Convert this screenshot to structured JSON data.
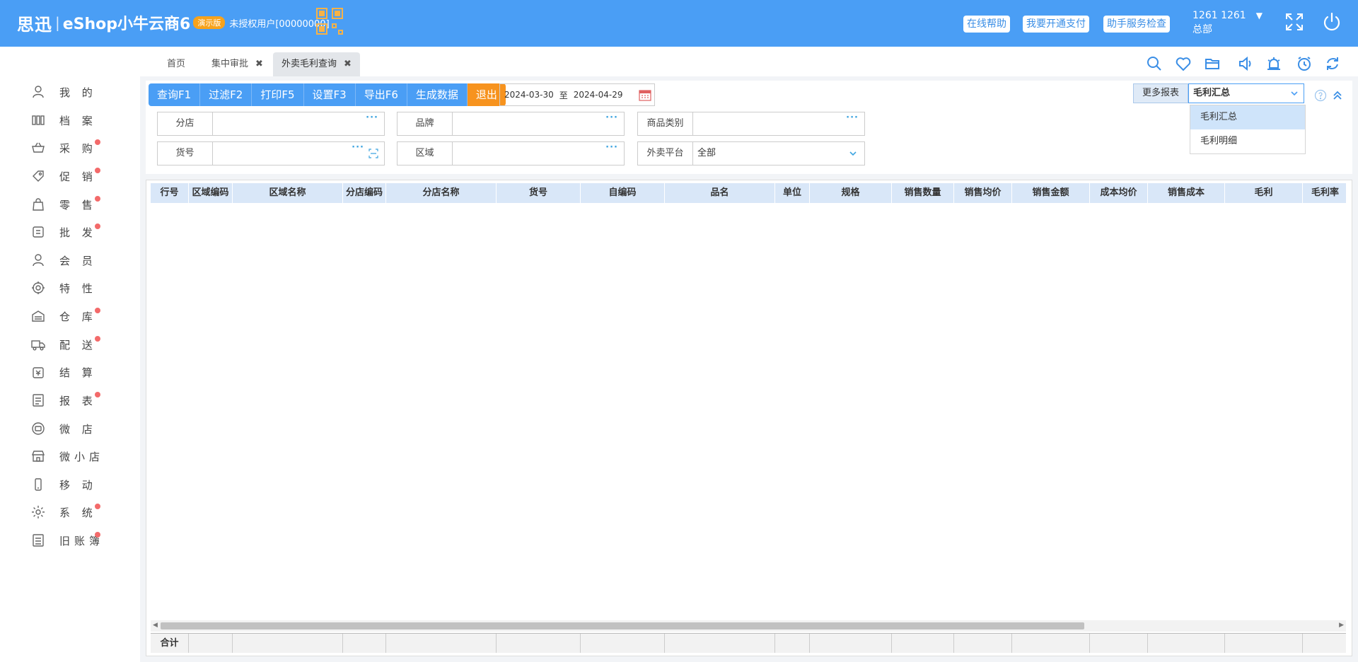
{
  "header": {
    "logo": "思迅",
    "product": "eShop小牛云商6",
    "edition_badge": "演示版",
    "license_user": "未授权用户[00000000]",
    "buttons": {
      "online_help": "在线帮助",
      "open_payment": "我要开通支付",
      "assistant_check": "助手服务检查"
    },
    "account": {
      "user": "1261 1261",
      "branch": "总部"
    },
    "icons": [
      "qrcode-icon",
      "fullscreen-icon",
      "power-icon"
    ]
  },
  "sidebar": {
    "items": [
      {
        "label": "我 的",
        "icon": "user-icon",
        "dot": false
      },
      {
        "label": "档 案",
        "icon": "archive-icon",
        "dot": false
      },
      {
        "label": "采 购",
        "icon": "basket-icon",
        "dot": true
      },
      {
        "label": "促 销",
        "icon": "tag-icon",
        "dot": true
      },
      {
        "label": "零 售",
        "icon": "bag-icon",
        "dot": true
      },
      {
        "label": "批 发",
        "icon": "wholesale-icon",
        "dot": true
      },
      {
        "label": "会 员",
        "icon": "member-icon",
        "dot": false
      },
      {
        "label": "特 性",
        "icon": "feature-icon",
        "dot": false
      },
      {
        "label": "仓 库",
        "icon": "warehouse-icon",
        "dot": true
      },
      {
        "label": "配 送",
        "icon": "truck-icon",
        "dot": true
      },
      {
        "label": "结 算",
        "icon": "settlement-icon",
        "dot": false
      },
      {
        "label": "报 表",
        "icon": "report-icon",
        "dot": true
      },
      {
        "label": "微 店",
        "icon": "wechat-shop-icon",
        "dot": false
      },
      {
        "label": "微小店",
        "icon": "mini-shop-icon",
        "dot": false
      },
      {
        "label": "移 动",
        "icon": "mobile-icon",
        "dot": false
      },
      {
        "label": "系 统",
        "icon": "gear-icon",
        "dot": true
      },
      {
        "label": "旧账簿",
        "icon": "ledger-icon",
        "dot": true
      }
    ]
  },
  "tabs": [
    {
      "label": "首页",
      "closable": false,
      "active": false
    },
    {
      "label": "集中审批",
      "closable": true,
      "active": false
    },
    {
      "label": "外卖毛利查询",
      "closable": true,
      "active": true
    }
  ],
  "tab_close_glyph": "✖",
  "toolbar": {
    "query": "查询F1",
    "filter": "过滤F2",
    "print": "打印F5",
    "settings": "设置F3",
    "export": "导出F6",
    "generate": "生成数据",
    "exit": "退出"
  },
  "date_range": {
    "start": "2024-03-30",
    "to": "至",
    "end": "2024-04-29"
  },
  "filters": {
    "branch": {
      "label": "分店",
      "value": ""
    },
    "brand": {
      "label": "品牌",
      "value": ""
    },
    "category": {
      "label": "商品类别",
      "value": ""
    },
    "item_no": {
      "label": "货号",
      "value": ""
    },
    "region": {
      "label": "区域",
      "value": ""
    },
    "platform": {
      "label": "外卖平台",
      "value": "全部"
    }
  },
  "more_reports": {
    "label": "更多报表",
    "selected": "毛利汇总",
    "options": [
      "毛利汇总",
      "毛利明细"
    ]
  },
  "grid": {
    "columns": [
      "行号",
      "区域编码",
      "区域名称",
      "分店编码",
      "分店名称",
      "货号",
      "自编码",
      "品名",
      "单位",
      "规格",
      "销售数量",
      "销售均价",
      "销售金额",
      "成本均价",
      "销售成本",
      "毛利",
      "毛利率"
    ],
    "rows": [],
    "footer_label": "合计"
  },
  "colors": {
    "primary": "#4a9ef5",
    "exit": "#f7931e",
    "dot": "#f36a6a",
    "header_row": "#d9e7f8"
  }
}
